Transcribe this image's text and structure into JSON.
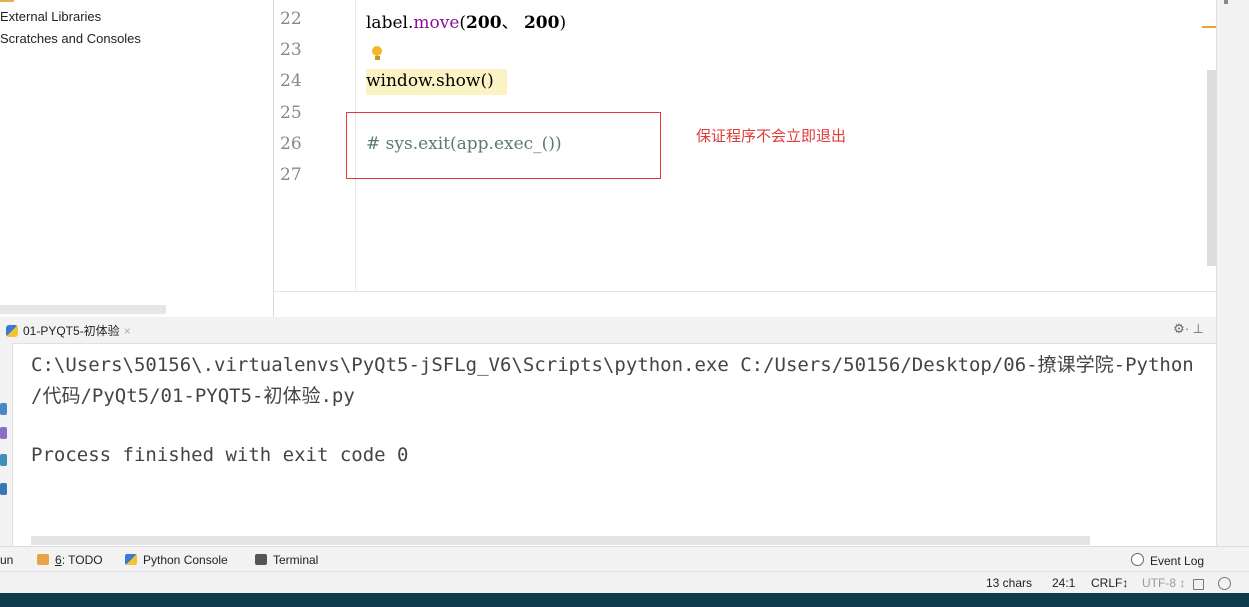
{
  "project_tree": {
    "items": [
      {
        "label": "External Libraries",
        "icon": "library-icon"
      },
      {
        "label": "Scratches and Consoles",
        "icon": "scratches-icon"
      }
    ]
  },
  "editor": {
    "line_numbers": [
      "22",
      "23",
      "24",
      "25",
      "26",
      "27"
    ],
    "lines": {
      "l22": {
        "obj": "label.",
        "method": "move",
        "open": "(",
        "arg1": "200",
        "sep": "、 ",
        "arg2": "200",
        "close": ")"
      },
      "l24": {
        "obj": "window.",
        "method": "show",
        "parens": "()"
      },
      "l26": {
        "comment": "# sys.exit(app.exec_())"
      }
    },
    "annotation": "保证程序不会立即退出"
  },
  "run_panel": {
    "tab_label": "01-PYQT5-初体验",
    "tab_close": "×",
    "tools": "⚙· ⊥",
    "console_lines": [
      "C:\\Users\\50156\\.virtualenvs\\PyQt5-jSFLg_V6\\Scripts\\python.exe C:/Users/50156/Desktop/06-撩课学院-Python",
      " /代码/PyQt5/01-PYQT5-初体验.py",
      "Process finished with exit code 0"
    ]
  },
  "tool_windows": {
    "run_label": "un",
    "todo_num": "6",
    "todo_label": ": TODO",
    "python_console": "Python Console",
    "terminal": "Terminal",
    "event_log": "Event Log"
  },
  "status_bar": {
    "chars": "13 chars",
    "position": "24:1",
    "line_sep": "CRLF↕",
    "encoding": "UTF-8 ↕"
  },
  "colors": {
    "annotation_red": "#e03a3a",
    "keyword_purple": "#871094",
    "number_blue": "#1750eb"
  }
}
